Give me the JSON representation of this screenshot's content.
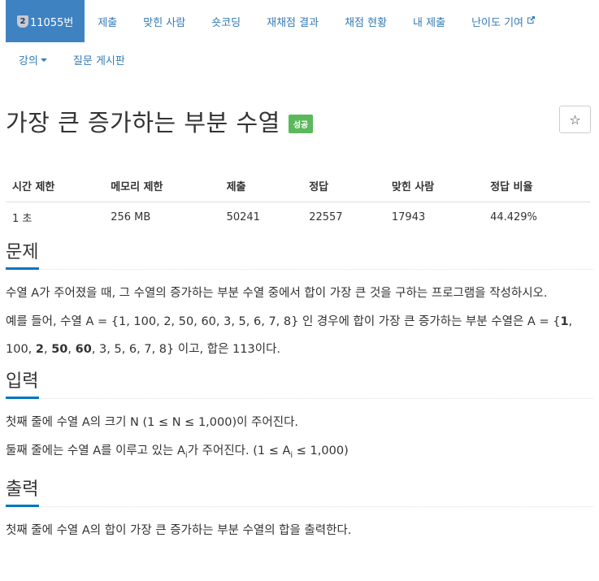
{
  "nav": {
    "items": [
      {
        "label": "11055번",
        "active": true,
        "tier_icon": "2"
      },
      {
        "label": "제출"
      },
      {
        "label": "맞힌 사람"
      },
      {
        "label": "숏코딩"
      },
      {
        "label": "재채점 결과"
      },
      {
        "label": "채점 현황"
      },
      {
        "label": "내 제출"
      },
      {
        "label": "난이도 기여"
      }
    ],
    "row2": [
      {
        "label": "강의"
      },
      {
        "label": "질문 게시판"
      }
    ]
  },
  "problem": {
    "title": "가장 큰 증가하는 부분 수열",
    "status_label": "성공",
    "star_icon": "☆"
  },
  "info": {
    "headers": [
      "시간 제한",
      "메모리 제한",
      "제출",
      "정답",
      "맞힌 사람",
      "정답 비율"
    ],
    "values": [
      "1 초",
      "256 MB",
      "50241",
      "22557",
      "17943",
      "44.429%"
    ]
  },
  "sections": {
    "problem_head": "문제",
    "problem_p1": "수열 A가 주어졌을 때, 그 수열의 증가하는 부분 수열 중에서 합이 가장 큰 것을 구하는 프로그램을 작성하시오.",
    "problem_p2_a": "예를 들어, 수열 A = {1, 100, 2, 50, 60, 3, 5, 6, 7, 8} 인 경우에 합이 가장 큰 증가하는 부분 수열은 A = {",
    "problem_p2_b1": "1",
    "problem_p2_c1": ", 100, ",
    "problem_p2_b2": "2",
    "problem_p2_c2": ", ",
    "problem_p2_b3": "50",
    "problem_p2_c3": ", ",
    "problem_p2_b4": "60",
    "problem_p2_c4": ", 3, 5, 6, 7, 8} 이고, 합은 113이다.",
    "input_head": "입력",
    "input_p1": "첫째 줄에 수열 A의 크기 N (1 ≤ N ≤ 1,000)이 주어진다.",
    "input_p2_a": "둘째 줄에는 수열 A를 이루고 있는 A",
    "input_p2_sub1": "i",
    "input_p2_b": "가 주어진다. (1 ≤ A",
    "input_p2_sub2": "i",
    "input_p2_c": " ≤ 1,000)",
    "output_head": "출력",
    "output_p1": "첫째 줄에 수열 A의 합이 가장 큰 증가하는 부분 수열의 합을 출력한다."
  },
  "colors": {
    "active_tab": "#3f82c2",
    "link": "#337ab7",
    "success": "#5cb85c",
    "section_underline": "#0076c0"
  }
}
